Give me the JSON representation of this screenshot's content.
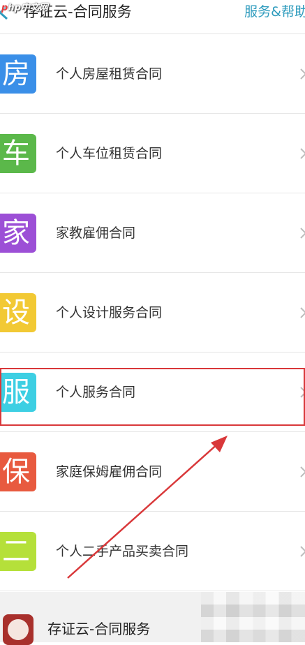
{
  "header": {
    "title": "存证云-合同服务",
    "help_label": "服务&帮助",
    "watermark": {
      "prefix": "p",
      "text": "hp中文网"
    }
  },
  "contracts": [
    {
      "badge_char": "房",
      "label": "个人房屋租赁合同",
      "color": "#3a8fe8"
    },
    {
      "badge_char": "车",
      "label": "个人车位租赁合同",
      "color": "#5bb84a"
    },
    {
      "badge_char": "家",
      "label": "家教雇佣合同",
      "color": "#9c4fd6"
    },
    {
      "badge_char": "设",
      "label": "个人设计服务合同",
      "color": "#f2c934"
    },
    {
      "badge_char": "服",
      "label": "个人服务合同",
      "color": "#3dcfe3"
    },
    {
      "badge_char": "保",
      "label": "家庭保姆雇佣合同",
      "color": "#e85a3f"
    },
    {
      "badge_char": "二",
      "label": "个人二手产品买卖合同",
      "color": "#b5e03a"
    }
  ],
  "footer": {
    "title": "存证云-合同服务"
  },
  "colors": {
    "accent": "#2d9bbd",
    "highlight": "#d9383a"
  },
  "icons": {
    "back": "back-chevron-icon",
    "row": "chevron-right-icon",
    "logo": "app-logo-icon"
  }
}
